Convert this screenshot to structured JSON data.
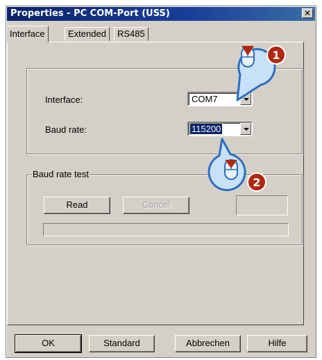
{
  "window": {
    "title": "Properties - PC COM-Port (USS)",
    "close_glyph": "✕"
  },
  "tabs": [
    {
      "label": "Interface",
      "active": true
    },
    {
      "label": "Extended",
      "active": false
    },
    {
      "label": "RS485",
      "active": false
    }
  ],
  "interface_group": {
    "interface_label": "Interface:",
    "interface_value": "COM7",
    "baud_label": "Baud rate:",
    "baud_value": "115200"
  },
  "baud_test": {
    "title": "Baud rate test",
    "read_label": "Read",
    "cancel_label": "Cancel",
    "result_value": "",
    "progress": 0
  },
  "footer": {
    "ok_label": "OK",
    "standard_label": "Standard",
    "cancel_label": "Abbrechen",
    "help_label": "Hilfe"
  },
  "callouts": [
    {
      "number": "1",
      "icon": "mouse-click-icon"
    },
    {
      "number": "2",
      "icon": "mouse-click-icon"
    }
  ],
  "colors": {
    "title_bar": "#0a246a",
    "dialog_face": "#d4d0c8",
    "selection": "#0a246a",
    "callout_fill": "#c8e0f8",
    "callout_stroke": "#2c6fc0",
    "badge": "#b02810"
  }
}
